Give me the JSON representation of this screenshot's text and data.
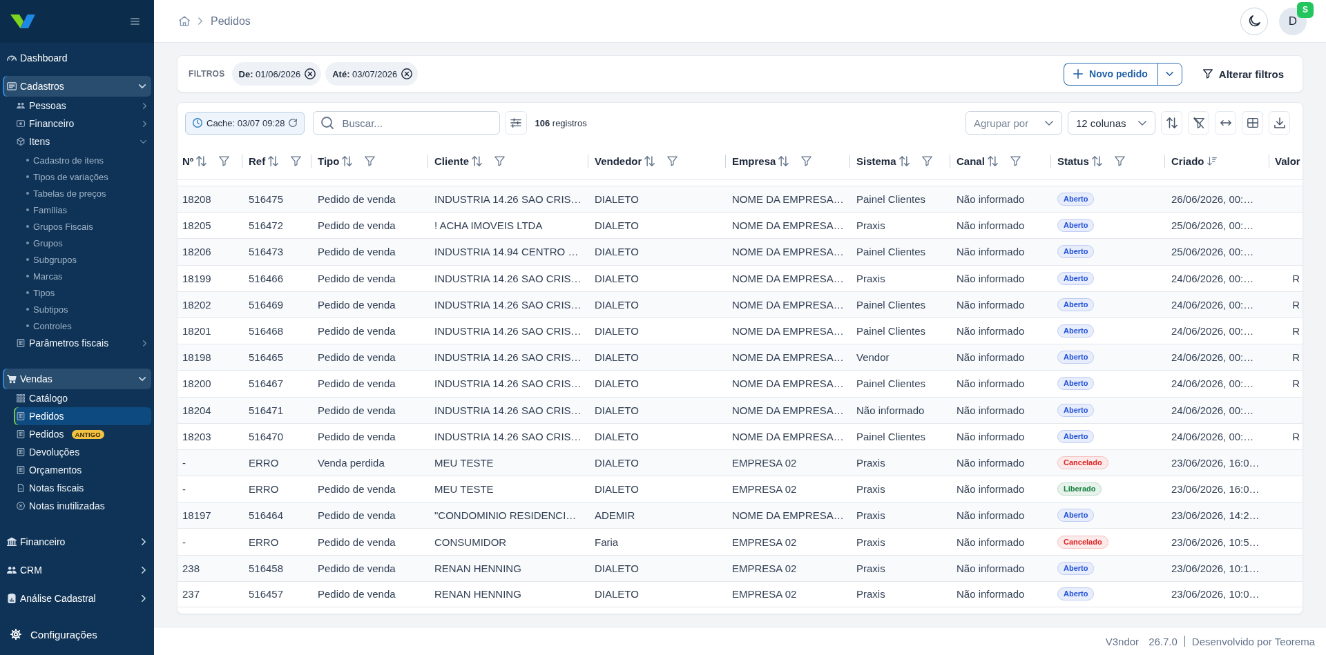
{
  "sidebar": {
    "items": [
      {
        "label": "Dashboard",
        "selected": false
      },
      {
        "label": "Cadastros",
        "selected": false,
        "expanded": true,
        "children": [
          {
            "label": "Pessoas",
            "selected": false,
            "expanded": false
          },
          {
            "label": "Financeiro",
            "selected": false,
            "expanded": false
          },
          {
            "label": "Itens",
            "selected": false,
            "expanded": true,
            "children": [
              {
                "label": "Cadastro de itens",
                "selected": false
              },
              {
                "label": "Tipos de variações",
                "selected": false
              },
              {
                "label": "Tabelas de preços",
                "selected": false
              },
              {
                "label": "Famílias",
                "selected": false
              },
              {
                "label": "Grupos Fiscais",
                "selected": false
              },
              {
                "label": "Grupos",
                "selected": false
              },
              {
                "label": "Subgrupos",
                "selected": false
              },
              {
                "label": "Marcas",
                "selected": false
              },
              {
                "label": "Tipos",
                "selected": false
              },
              {
                "label": "Subtipos",
                "selected": false
              },
              {
                "label": "Controles",
                "selected": false
              }
            ]
          },
          {
            "label": "Parâmetros fiscais",
            "selected": false,
            "expanded": false
          }
        ]
      },
      {
        "label": "Vendas",
        "selected": false,
        "expanded": true,
        "children": [
          {
            "label": "Catálogo",
            "selected": false
          },
          {
            "label": "Pedidos",
            "selected": true
          },
          {
            "label": "Pedidos",
            "badge": "ANTIGO",
            "selected": false
          },
          {
            "label": "Devoluções",
            "selected": false
          },
          {
            "label": "Orçamentos",
            "selected": false
          },
          {
            "label": "Notas fiscais",
            "selected": false
          },
          {
            "label": "Notas inutilizadas",
            "selected": false
          }
        ]
      },
      {
        "label": "Financeiro",
        "selected": false,
        "expanded": false
      },
      {
        "label": "CRM",
        "selected": false,
        "expanded": false
      },
      {
        "label": "Análise Cadastral",
        "selected": false,
        "expanded": false
      }
    ],
    "settings": {
      "label": "Configurações",
      "selected": false
    }
  },
  "topbar": {
    "breadcrumb": [
      "Pedidos"
    ],
    "user": {
      "initial": "D",
      "badge": "S"
    }
  },
  "filters": {
    "title": "FILTROS",
    "chips": [
      {
        "text": "**De:** 01/06/2026"
      },
      {
        "text": "**Até:** 03/07/2026"
      }
    ],
    "new_button": "Novo pedido",
    "edit_button": "Alterar filtros"
  },
  "table": {
    "cache": "Cache: 03/07 09:28",
    "search": {
      "placeholder": "Buscar..."
    },
    "count": "**106** registros",
    "group_by": {
      "placeholder": "Agrupar por"
    },
    "column_picker": {
      "value": "12 colunas"
    },
    "columns": [
      {
        "label": "Nº",
        "kind": "filterable"
      },
      {
        "label": "Ref",
        "kind": "filterable"
      },
      {
        "label": "Tipo",
        "kind": "filterable"
      },
      {
        "label": "Cliente",
        "kind": "filterable"
      },
      {
        "label": "Vendedor",
        "kind": "filterable"
      },
      {
        "label": "Empresa",
        "kind": "filterable"
      },
      {
        "label": "Sistema",
        "kind": "filterable"
      },
      {
        "label": "Canal",
        "kind": "filterable"
      },
      {
        "label": "Status",
        "kind": "filterable"
      },
      {
        "label": "Criado",
        "kind": "sorted"
      },
      {
        "label": "Valor",
        "kind": "plain"
      }
    ],
    "rows": [
      {
        "number": "18208",
        "ref": "516475",
        "type": "Pedido de venda",
        "client": "INDUSTRIA 14.26 SAO CRIS…",
        "seller": "DIALETO",
        "company": "NOME DA EMPRESA…",
        "system": "Painel Clientes",
        "channel": "Não informado",
        "status": {
          "label": "Aberto",
          "color": "#1d4ed8"
        },
        "created": "26/06/2026, 00:…"
      },
      {
        "number": "18205",
        "ref": "516472",
        "type": "Pedido de venda",
        "client": "! ACHA IMOVEIS LTDA",
        "seller": "DIALETO",
        "company": "NOME DA EMPRESA…",
        "system": "Praxis",
        "channel": "Não informado",
        "status": {
          "label": "Aberto",
          "color": "#1d4ed8"
        },
        "created": "25/06/2026, 00:…"
      },
      {
        "number": "18206",
        "ref": "516473",
        "type": "Pedido de venda",
        "client": "INDUSTRIA 14.94 CENTRO …",
        "seller": "DIALETO",
        "company": "NOME DA EMPRESA…",
        "system": "Painel Clientes",
        "channel": "Não informado",
        "status": {
          "label": "Aberto",
          "color": "#1d4ed8"
        },
        "created": "25/06/2026, 00:…"
      },
      {
        "number": "18199",
        "ref": "516466",
        "type": "Pedido de venda",
        "client": "INDUSTRIA 14.26 SAO CRIS…",
        "seller": "DIALETO",
        "company": "NOME DA EMPRESA…",
        "system": "Praxis",
        "channel": "Não informado",
        "status": {
          "label": "Aberto",
          "color": "#1d4ed8"
        },
        "created": "24/06/2026, 00:…",
        "value": "R"
      },
      {
        "number": "18202",
        "ref": "516469",
        "type": "Pedido de venda",
        "client": "INDUSTRIA 14.26 SAO CRIS…",
        "seller": "DIALETO",
        "company": "NOME DA EMPRESA…",
        "system": "Painel Clientes",
        "channel": "Não informado",
        "status": {
          "label": "Aberto",
          "color": "#1d4ed8"
        },
        "created": "24/06/2026, 00:…",
        "value": "R"
      },
      {
        "number": "18201",
        "ref": "516468",
        "type": "Pedido de venda",
        "client": "INDUSTRIA 14.26 SAO CRIS…",
        "seller": "DIALETO",
        "company": "NOME DA EMPRESA…",
        "system": "Painel Clientes",
        "channel": "Não informado",
        "status": {
          "label": "Aberto",
          "color": "#1d4ed8"
        },
        "created": "24/06/2026, 00:…",
        "value": "R"
      },
      {
        "number": "18198",
        "ref": "516465",
        "type": "Pedido de venda",
        "client": "INDUSTRIA 14.26 SAO CRIS…",
        "seller": "DIALETO",
        "company": "NOME DA EMPRESA…",
        "system": "Vendor",
        "channel": "Não informado",
        "status": {
          "label": "Aberto",
          "color": "#1d4ed8"
        },
        "created": "24/06/2026, 00:…",
        "value": "R"
      },
      {
        "number": "18200",
        "ref": "516467",
        "type": "Pedido de venda",
        "client": "INDUSTRIA 14.26 SAO CRIS…",
        "seller": "DIALETO",
        "company": "NOME DA EMPRESA…",
        "system": "Painel Clientes",
        "channel": "Não informado",
        "status": {
          "label": "Aberto",
          "color": "#1d4ed8"
        },
        "created": "24/06/2026, 00:…",
        "value": "R"
      },
      {
        "number": "18204",
        "ref": "516471",
        "type": "Pedido de venda",
        "client": "INDUSTRIA 14.26 SAO CRIS…",
        "seller": "DIALETO",
        "company": "NOME DA EMPRESA…",
        "system": "Não informado",
        "channel": "Não informado",
        "status": {
          "label": "Aberto",
          "color": "#1d4ed8"
        },
        "created": "24/06/2026, 00:…"
      },
      {
        "number": "18203",
        "ref": "516470",
        "type": "Pedido de venda",
        "client": "INDUSTRIA 14.26 SAO CRIS…",
        "seller": "DIALETO",
        "company": "NOME DA EMPRESA…",
        "system": "Painel Clientes",
        "channel": "Não informado",
        "status": {
          "label": "Aberto",
          "color": "#1d4ed8"
        },
        "created": "24/06/2026, 00:…",
        "value": "R"
      },
      {
        "number": "-",
        "ref": "ERRO",
        "type": "Venda perdida",
        "client": "MEU TESTE",
        "seller": "DIALETO",
        "company": "EMPRESA 02",
        "system": "Praxis",
        "channel": "Não informado",
        "status": {
          "label": "Cancelado",
          "color": "#dc2626"
        },
        "created": "23/06/2026, 16:0…"
      },
      {
        "number": "-",
        "ref": "ERRO",
        "type": "Pedido de venda",
        "client": "MEU TESTE",
        "seller": "DIALETO",
        "company": "EMPRESA 02",
        "system": "Praxis",
        "channel": "Não informado",
        "status": {
          "label": "Liberado",
          "color": "#15803d"
        },
        "created": "23/06/2026, 16:0…"
      },
      {
        "number": "18197",
        "ref": "516464",
        "type": "Pedido de venda",
        "client": "\"CONDOMINIO RESIDENCI…",
        "seller": "ADEMIR",
        "company": "NOME DA EMPRESA…",
        "system": "Praxis",
        "channel": "Não informado",
        "status": {
          "label": "Aberto",
          "color": "#1d4ed8"
        },
        "created": "23/06/2026, 14:2…"
      },
      {
        "number": "-",
        "ref": "ERRO",
        "type": "Pedido de venda",
        "client": "CONSUMIDOR",
        "seller": "Faria",
        "company": "EMPRESA 02",
        "system": "Praxis",
        "channel": "Não informado",
        "status": {
          "label": "Cancelado",
          "color": "#dc2626"
        },
        "created": "23/06/2026, 10:5…"
      },
      {
        "number": "238",
        "ref": "516458",
        "type": "Pedido de venda",
        "client": "RENAN HENNING",
        "seller": "DIALETO",
        "company": "EMPRESA 02",
        "system": "Praxis",
        "channel": "Não informado",
        "status": {
          "label": "Aberto",
          "color": "#1d4ed8"
        },
        "created": "23/06/2026, 10:1…"
      },
      {
        "number": "237",
        "ref": "516457",
        "type": "Pedido de venda",
        "client": "RENAN HENNING",
        "seller": "DIALETO",
        "company": "EMPRESA 02",
        "system": "Praxis",
        "channel": "Não informado",
        "status": {
          "label": "Aberto",
          "color": "#1d4ed8"
        },
        "created": "23/06/2026, 10:0…"
      }
    ]
  },
  "footer": {
    "product": "V3ndor",
    "version": "26.7.0",
    "credit": "Desenvolvido por Teorema"
  }
}
